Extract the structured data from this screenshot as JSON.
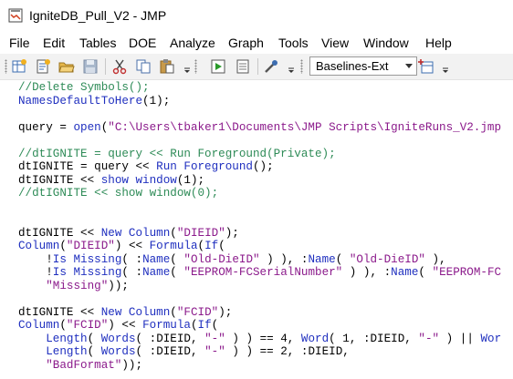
{
  "window": {
    "title": "IgniteDB_Pull_V2 - JMP",
    "app_icon": "jmp-app-icon"
  },
  "menu": [
    {
      "label": "File"
    },
    {
      "label": "Edit"
    },
    {
      "label": "Tables"
    },
    {
      "label": "DOE"
    },
    {
      "label": "Analyze"
    },
    {
      "label": "Graph"
    },
    {
      "label": "Tools"
    },
    {
      "label": "View"
    },
    {
      "label": "Window"
    },
    {
      "label": "Help"
    }
  ],
  "toolbar": {
    "buttons": [
      {
        "icon": "new-data-table-icon"
      },
      {
        "icon": "new-script-icon"
      },
      {
        "icon": "open-folder-icon"
      },
      {
        "icon": "save-icon"
      },
      {
        "icon": "cut-icon"
      },
      {
        "icon": "copy-icon"
      },
      {
        "icon": "paste-icon"
      },
      {
        "icon": "run-script-icon"
      },
      {
        "icon": "journal-icon"
      },
      {
        "icon": "tools-icon"
      },
      {
        "icon": "add-connection-icon"
      }
    ],
    "dropdown_value": "Baselines-Ext"
  },
  "colors": {
    "comment": "#2e8b57",
    "keyword": "#1f2fbf",
    "string": "#8b1a8b",
    "text": "#000000"
  },
  "code_lines": [
    {
      "tokens": [
        {
          "t": "//Delete Symbols();",
          "c": "comment"
        }
      ]
    },
    {
      "tokens": [
        {
          "t": "NamesDefaultToHere",
          "c": "fn"
        },
        {
          "t": "(",
          "c": "plain"
        },
        {
          "t": "1",
          "c": "num"
        },
        {
          "t": ");",
          "c": "plain"
        }
      ]
    },
    {
      "tokens": []
    },
    {
      "tokens": [
        {
          "t": "query = ",
          "c": "plain"
        },
        {
          "t": "open",
          "c": "fn"
        },
        {
          "t": "(",
          "c": "plain"
        },
        {
          "t": "\"C:\\Users\\tbaker1\\Documents\\JMP Scripts\\IgniteRuns_V2.jmp",
          "c": "str"
        }
      ]
    },
    {
      "tokens": []
    },
    {
      "tokens": [
        {
          "t": "//dtIGNITE = query << Run Foreground(Private);",
          "c": "comment"
        }
      ]
    },
    {
      "tokens": [
        {
          "t": "dtIGNITE = query << ",
          "c": "plain"
        },
        {
          "t": "Run Foreground",
          "c": "fn"
        },
        {
          "t": "();",
          "c": "plain"
        }
      ]
    },
    {
      "tokens": [
        {
          "t": "dtIGNITE << ",
          "c": "plain"
        },
        {
          "t": "show window",
          "c": "fn"
        },
        {
          "t": "(",
          "c": "plain"
        },
        {
          "t": "1",
          "c": "num"
        },
        {
          "t": ");",
          "c": "plain"
        }
      ]
    },
    {
      "tokens": [
        {
          "t": "//dtIGNITE << show window(0);",
          "c": "comment"
        }
      ]
    },
    {
      "tokens": []
    },
    {
      "tokens": []
    },
    {
      "tokens": [
        {
          "t": "dtIGNITE << ",
          "c": "plain"
        },
        {
          "t": "New Column",
          "c": "fn"
        },
        {
          "t": "(",
          "c": "plain"
        },
        {
          "t": "\"DIEID\"",
          "c": "str"
        },
        {
          "t": ");",
          "c": "plain"
        }
      ]
    },
    {
      "tokens": [
        {
          "t": "Column",
          "c": "fn"
        },
        {
          "t": "(",
          "c": "plain"
        },
        {
          "t": "\"DIEID\"",
          "c": "str"
        },
        {
          "t": ") << ",
          "c": "plain"
        },
        {
          "t": "Formula",
          "c": "fn"
        },
        {
          "t": "(",
          "c": "plain"
        },
        {
          "t": "If",
          "c": "fn"
        },
        {
          "t": "(",
          "c": "plain"
        }
      ]
    },
    {
      "tokens": [
        {
          "t": "    !",
          "c": "plain"
        },
        {
          "t": "Is Missing",
          "c": "fn"
        },
        {
          "t": "( :",
          "c": "plain"
        },
        {
          "t": "Name",
          "c": "fn"
        },
        {
          "t": "( ",
          "c": "plain"
        },
        {
          "t": "\"Old-DieID\"",
          "c": "str"
        },
        {
          "t": " ) ), :",
          "c": "plain"
        },
        {
          "t": "Name",
          "c": "fn"
        },
        {
          "t": "( ",
          "c": "plain"
        },
        {
          "t": "\"Old-DieID\"",
          "c": "str"
        },
        {
          "t": " ),",
          "c": "plain"
        }
      ]
    },
    {
      "tokens": [
        {
          "t": "    !",
          "c": "plain"
        },
        {
          "t": "Is Missing",
          "c": "fn"
        },
        {
          "t": "( :",
          "c": "plain"
        },
        {
          "t": "Name",
          "c": "fn"
        },
        {
          "t": "( ",
          "c": "plain"
        },
        {
          "t": "\"EEPROM-FCSerialNumber\"",
          "c": "str"
        },
        {
          "t": " ) ), :",
          "c": "plain"
        },
        {
          "t": "Name",
          "c": "fn"
        },
        {
          "t": "( ",
          "c": "plain"
        },
        {
          "t": "\"EEPROM-FC",
          "c": "str"
        }
      ]
    },
    {
      "tokens": [
        {
          "t": "    ",
          "c": "plain"
        },
        {
          "t": "\"Missing\"",
          "c": "str"
        },
        {
          "t": "));",
          "c": "plain"
        }
      ]
    },
    {
      "tokens": []
    },
    {
      "tokens": [
        {
          "t": "dtIGNITE << ",
          "c": "plain"
        },
        {
          "t": "New Column",
          "c": "fn"
        },
        {
          "t": "(",
          "c": "plain"
        },
        {
          "t": "\"FCID\"",
          "c": "str"
        },
        {
          "t": ");",
          "c": "plain"
        }
      ]
    },
    {
      "tokens": [
        {
          "t": "Column",
          "c": "fn"
        },
        {
          "t": "(",
          "c": "plain"
        },
        {
          "t": "\"FCID\"",
          "c": "str"
        },
        {
          "t": ") << ",
          "c": "plain"
        },
        {
          "t": "Formula",
          "c": "fn"
        },
        {
          "t": "(",
          "c": "plain"
        },
        {
          "t": "If",
          "c": "fn"
        },
        {
          "t": "(",
          "c": "plain"
        }
      ]
    },
    {
      "tokens": [
        {
          "t": "    ",
          "c": "plain"
        },
        {
          "t": "Length",
          "c": "fn"
        },
        {
          "t": "( ",
          "c": "plain"
        },
        {
          "t": "Words",
          "c": "fn"
        },
        {
          "t": "( :DIEID, ",
          "c": "plain"
        },
        {
          "t": "\"-\"",
          "c": "str"
        },
        {
          "t": " ) ) == 4, ",
          "c": "plain"
        },
        {
          "t": "Word",
          "c": "fn"
        },
        {
          "t": "( 1, :DIEID, ",
          "c": "plain"
        },
        {
          "t": "\"-\"",
          "c": "str"
        },
        {
          "t": " ) || ",
          "c": "plain"
        },
        {
          "t": "Wor",
          "c": "fn"
        }
      ]
    },
    {
      "tokens": [
        {
          "t": "    ",
          "c": "plain"
        },
        {
          "t": "Length",
          "c": "fn"
        },
        {
          "t": "( ",
          "c": "plain"
        },
        {
          "t": "Words",
          "c": "fn"
        },
        {
          "t": "( :DIEID, ",
          "c": "plain"
        },
        {
          "t": "\"-\"",
          "c": "str"
        },
        {
          "t": " ) ) == 2, :DIEID,",
          "c": "plain"
        }
      ]
    },
    {
      "tokens": [
        {
          "t": "    ",
          "c": "plain"
        },
        {
          "t": "\"BadFormat\"",
          "c": "str"
        },
        {
          "t": "));",
          "c": "plain"
        }
      ]
    }
  ]
}
